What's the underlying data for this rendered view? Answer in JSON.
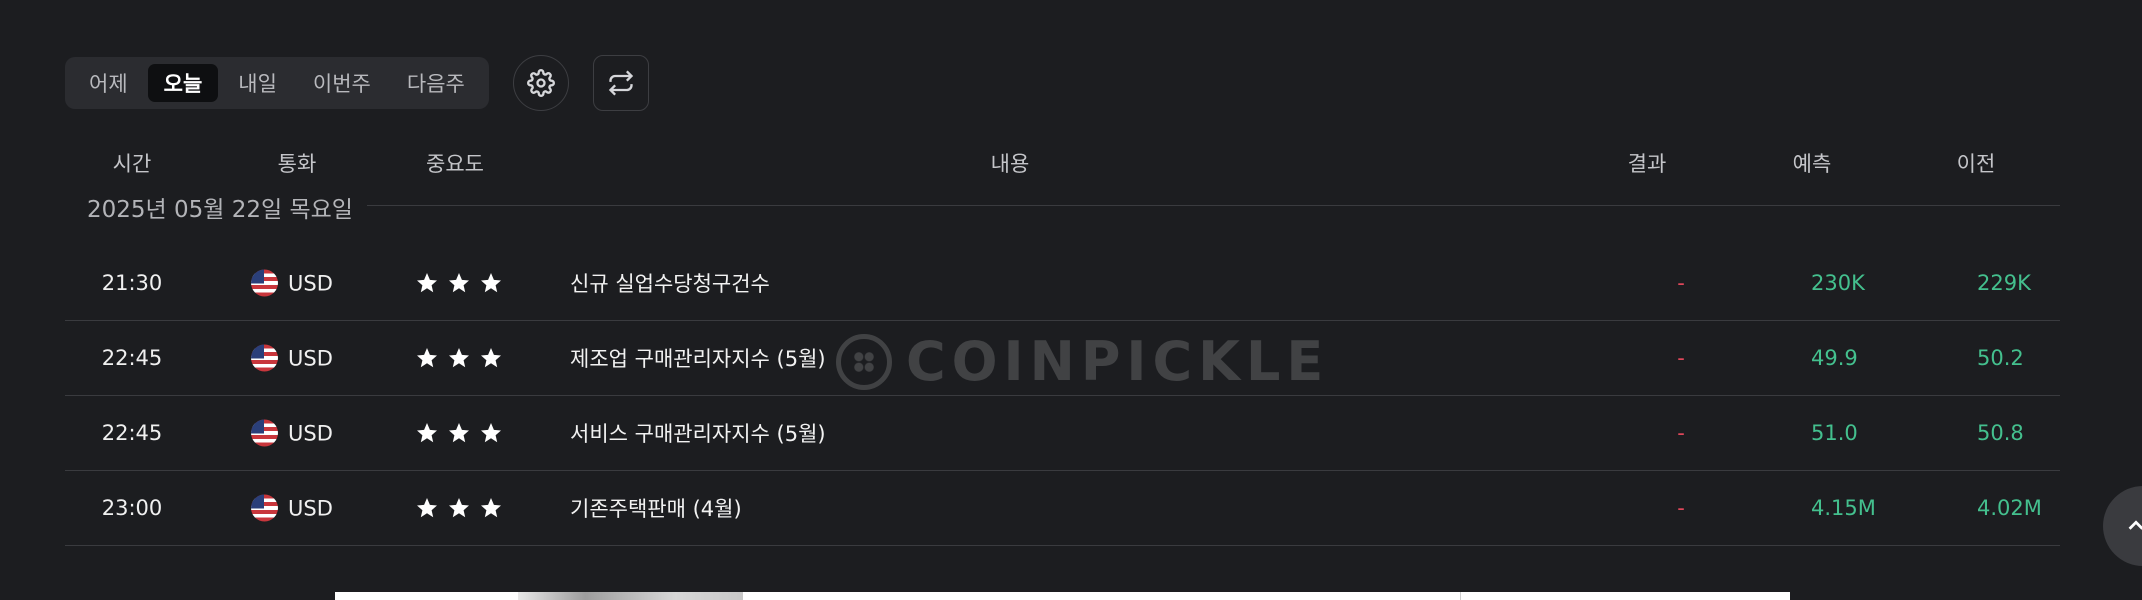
{
  "tabs": [
    {
      "label": "어제",
      "active": false
    },
    {
      "label": "오늘",
      "active": true
    },
    {
      "label": "내일",
      "active": false
    },
    {
      "label": "이번주",
      "active": false
    },
    {
      "label": "다음주",
      "active": false
    }
  ],
  "icons": {
    "settings": "gear-icon",
    "refresh": "refresh-icon",
    "scroll_top": "chevron-up-icon"
  },
  "columns": {
    "time": "시간",
    "currency": "통화",
    "importance": "중요도",
    "content": "내용",
    "result": "결과",
    "forecast": "예측",
    "previous": "이전"
  },
  "date_label": "2025년 05월 22일 목요일",
  "events": [
    {
      "time": "21:30",
      "currency": "USD",
      "importance": 3,
      "title": "신규 실업수당청구건수",
      "result": "-",
      "forecast": "230K",
      "previous": "229K"
    },
    {
      "time": "22:45",
      "currency": "USD",
      "importance": 3,
      "title": "제조업 구매관리자지수 (5월)",
      "result": "-",
      "forecast": "49.9",
      "previous": "50.2"
    },
    {
      "time": "22:45",
      "currency": "USD",
      "importance": 3,
      "title": "서비스 구매관리자지수 (5월)",
      "result": "-",
      "forecast": "51.0",
      "previous": "50.8"
    },
    {
      "time": "23:00",
      "currency": "USD",
      "importance": 3,
      "title": "기존주택판매 (4월)",
      "result": "-",
      "forecast": "4.15M",
      "previous": "4.02M"
    }
  ],
  "watermark": "COINPICKLE",
  "colors": {
    "background": "#1c1d20",
    "positive": "#44c08e",
    "negative": "#e0475a",
    "tab_active_bg": "#0e0f11"
  }
}
